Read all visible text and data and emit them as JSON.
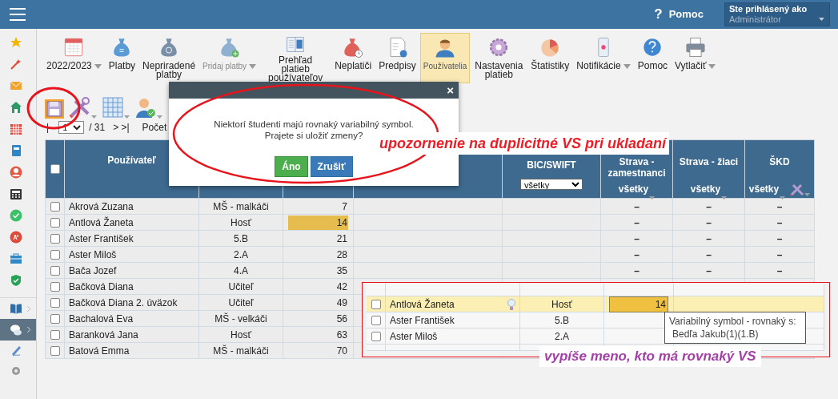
{
  "topbar": {
    "help_icon": "?",
    "help": "Pomoc",
    "login_label": "Ste prihlásený ako",
    "login_value": "Administrátor"
  },
  "sidebar": {
    "items": [
      {
        "selected": false,
        "submenu": false
      },
      {
        "selected": false,
        "submenu": false
      },
      {
        "selected": false,
        "submenu": false
      },
      {
        "selected": false,
        "submenu": false
      },
      {
        "selected": false,
        "submenu": false
      },
      {
        "selected": false,
        "submenu": false
      },
      {
        "selected": false,
        "submenu": false
      },
      {
        "selected": false,
        "submenu": false
      },
      {
        "selected": false,
        "submenu": false
      },
      {
        "selected": false,
        "submenu": false
      },
      {
        "selected": false,
        "submenu": false
      },
      {
        "selected": false,
        "submenu": false
      },
      {
        "selected": false,
        "submenu": true
      },
      {
        "selected": true,
        "submenu": true
      },
      {
        "selected": false,
        "submenu": false
      },
      {
        "selected": false,
        "submenu": false
      }
    ]
  },
  "toolbar": {
    "items": [
      {
        "label": "2022/2023",
        "selected": false,
        "dropdown": true,
        "disabled": false
      },
      {
        "label": "Platby",
        "selected": false,
        "dropdown": false,
        "disabled": false
      },
      {
        "label": "Nepriradené platby",
        "selected": false,
        "dropdown": false,
        "disabled": false
      },
      {
        "label": "Pridaj platby",
        "selected": false,
        "dropdown": true,
        "disabled": true
      },
      {
        "label": "Prehľad platieb používateľov",
        "selected": false,
        "dropdown": false,
        "disabled": false
      },
      {
        "label": "Neplatiči",
        "selected": false,
        "dropdown": false,
        "disabled": false
      },
      {
        "label": "Predpisy",
        "selected": false,
        "dropdown": false,
        "disabled": false
      },
      {
        "label": "Používatelia",
        "selected": true,
        "dropdown": false,
        "disabled": false
      },
      {
        "label": "Nastavenia platieb",
        "selected": false,
        "dropdown": false,
        "disabled": false
      },
      {
        "label": "Štatistiky",
        "selected": false,
        "dropdown": false,
        "disabled": false
      },
      {
        "label": "Notifikácie",
        "selected": false,
        "dropdown": true,
        "disabled": false
      },
      {
        "label": "Pomoc",
        "selected": false,
        "dropdown": false,
        "disabled": false
      },
      {
        "label": "Vytlačiť",
        "selected": false,
        "dropdown": true,
        "disabled": false
      }
    ]
  },
  "pager": {
    "first": "|",
    "page": "1",
    "total": "/ 31",
    "next": "> >|",
    "count_label": "Počet"
  },
  "table": {
    "all_checked": false,
    "columns": [
      {
        "kind": "checkbox"
      },
      {
        "kind": "plain",
        "label": "Používateľ"
      },
      {
        "kind": "covered"
      },
      {
        "kind": "covered"
      },
      {
        "kind": "covered"
      },
      {
        "kind": "select",
        "label": "BIC/SWIFT",
        "filter": "všetky"
      },
      {
        "kind": "dropdown",
        "label": "Strava - zamestnanci",
        "filter": "všetky"
      },
      {
        "kind": "dropdown",
        "label": "Strava - žiaci",
        "filter": "všetky"
      },
      {
        "kind": "tools",
        "label": "ŠKD",
        "filter": "všetky"
      }
    ],
    "rows": [
      {
        "checked": false,
        "name": "Akrová Zuzana",
        "group": "MŠ - malkáči",
        "vs": "7",
        "duplicate": false,
        "strava_zam": "–",
        "strava_ziaci": "–",
        "skd": "–"
      },
      {
        "checked": false,
        "name": "Antlová Žaneta",
        "group": "Hosť",
        "vs": "14",
        "duplicate": true,
        "strava_zam": "–",
        "strava_ziaci": "–",
        "skd": "–"
      },
      {
        "checked": false,
        "name": "Aster František",
        "group": "5.B",
        "vs": "21",
        "duplicate": false,
        "strava_zam": "–",
        "strava_ziaci": "–",
        "skd": "–"
      },
      {
        "checked": false,
        "name": "Aster Miloš",
        "group": "2.A",
        "vs": "28",
        "duplicate": false,
        "strava_zam": "–",
        "strava_ziaci": "–",
        "skd": "–"
      },
      {
        "checked": false,
        "name": "Bača Jozef",
        "group": "4.A",
        "vs": "35",
        "duplicate": false,
        "strava_zam": "–",
        "strava_ziaci": "–",
        "skd": "–"
      },
      {
        "checked": false,
        "name": "Bačková Diana",
        "group": "Učiteľ",
        "vs": "42",
        "duplicate": false
      },
      {
        "checked": false,
        "name": "Bačková Diana 2. úväzok",
        "group": "Učiteľ",
        "vs": "49",
        "duplicate": false
      },
      {
        "checked": false,
        "name": "Bachalová Eva",
        "group": "MŠ - velkáči",
        "vs": "56",
        "duplicate": false
      },
      {
        "checked": false,
        "name": "Baranková Jana",
        "group": "Hosť",
        "vs": "63",
        "duplicate": false
      },
      {
        "checked": false,
        "name": "Batová Emma",
        "group": "MŠ - malkáči",
        "vs": "70",
        "duplicate": false
      }
    ]
  },
  "dialog": {
    "close": "×",
    "message": [
      "Niektorí študenti majú rovnaký variabilný symbol.",
      "Prajete si uložiť zmeny?"
    ],
    "buttons": [
      {
        "label": "Áno",
        "kind": "confirm"
      },
      {
        "label": "Zrušiť",
        "kind": "cancel"
      }
    ]
  },
  "annotations": [
    {
      "text": "upozornenie na duplicitné VS pri ukladaní",
      "color": "#ee1c25"
    },
    {
      "text": "vypíše meno, kto má rovnaký VS",
      "color": "#a43fa8"
    }
  ],
  "inset": {
    "rows": [
      {
        "checked": false,
        "name": "Antlová Žaneta",
        "group": "Hosť",
        "vs": "14",
        "selected": true,
        "hint": true
      },
      {
        "checked": false,
        "name": "Aster František",
        "group": "5.B",
        "selected": false,
        "hint": false
      },
      {
        "checked": false,
        "name": "Aster Miloš",
        "group": "2.A",
        "selected": false,
        "hint": false
      }
    ],
    "tooltip": {
      "title": "Variabilný symbol - rovnaký s:",
      "text": "Bedľa Jakub(1)(1.B)"
    }
  }
}
